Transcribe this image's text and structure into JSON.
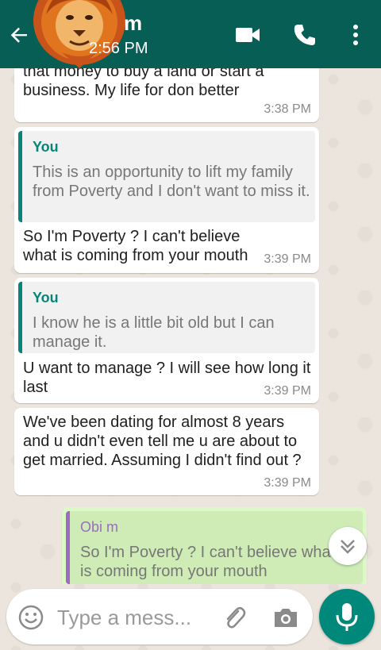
{
  "header": {
    "contact_name": "m",
    "status": "2:56 PM",
    "icons": [
      "back-arrow-icon",
      "video-call-icon",
      "phone-call-icon",
      "more-options-icon"
    ]
  },
  "messages": [
    {
      "direction": "incoming",
      "text": "that money to buy a land or start a business. My life for don better",
      "time": "3:38 PM"
    },
    {
      "direction": "incoming",
      "quote": {
        "name": "You",
        "text": "This is an opportunity to lift my family from Poverty and I don't want to miss it."
      },
      "text": "So I'm Poverty ? I can't believe what is coming from your mouth",
      "time": "3:39 PM"
    },
    {
      "direction": "incoming",
      "quote": {
        "name": "You",
        "text": "I know he is a little bit old but I can manage it."
      },
      "text": "U want to manage ? I will see how long it last",
      "time": "3:39 PM"
    },
    {
      "direction": "incoming",
      "text": "We've been dating for almost 8 years and u didn't even tell me u are about to get married. Assuming I didn't find out ?",
      "time": "3:39 PM"
    },
    {
      "direction": "outgoing",
      "quote": {
        "name": "Obi m",
        "text": "So I'm Poverty ? I can't believe what is coming from your mouth"
      }
    }
  ],
  "composer": {
    "placeholder": "Type a mess...",
    "icons": [
      "emoji-icon",
      "attach-icon",
      "camera-icon",
      "mic-icon"
    ]
  },
  "colors": {
    "header": "#075e54",
    "accent": "#00897b",
    "quote_you": "#06867a",
    "quote_other": "#9b6cc1",
    "outgoing_bubble": "#dcf8c6"
  }
}
